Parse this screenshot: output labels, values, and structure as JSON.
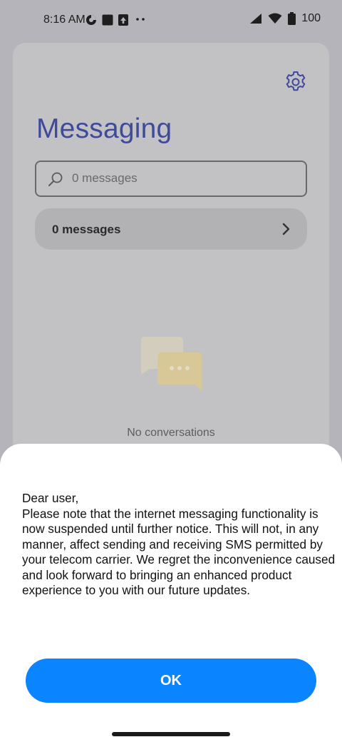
{
  "status_bar": {
    "time": "8:16 AM",
    "battery": "100",
    "left_icons": [
      "data-saver-icon",
      "square-icon",
      "upload-icon",
      "more-dots-icon"
    ],
    "right_icons": [
      "cellular-signal-icon",
      "wifi-icon",
      "battery-icon"
    ]
  },
  "app": {
    "title": "Messaging",
    "search": {
      "placeholder": "0 messages",
      "value": ""
    },
    "filter_row": {
      "label": "0 messages"
    },
    "empty_state": {
      "text": "No conversations"
    }
  },
  "dialog": {
    "greeting": "Dear user,",
    "body": "Please note that the internet messaging functionality is now suspended until further notice. This will not, in any manner, affect sending and receiving SMS permitted by your telecom carrier. We regret the inconvenience caused and look forward to bringing an enhanced product experience to you with our future updates.",
    "ok_label": "OK"
  },
  "colors": {
    "accent": "#0a84ff",
    "title": "#3f4a9a",
    "scrim": "#b4b4ba"
  }
}
